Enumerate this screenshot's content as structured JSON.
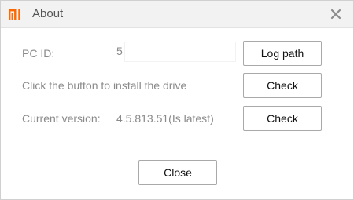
{
  "window": {
    "title": "About",
    "logo_text": "mi",
    "accent_color": "#ff6700",
    "close_icon": "close-icon"
  },
  "rows": {
    "pc_id": {
      "label": "PC ID:",
      "value": "5",
      "button_label": "Log path"
    },
    "driver": {
      "label": "Click the button to install the drive",
      "button_label": "Check"
    },
    "version": {
      "label": "Current version:",
      "value": "4.5.813.51(Is latest)",
      "button_label": "Check"
    }
  },
  "footer": {
    "close_label": "Close"
  }
}
